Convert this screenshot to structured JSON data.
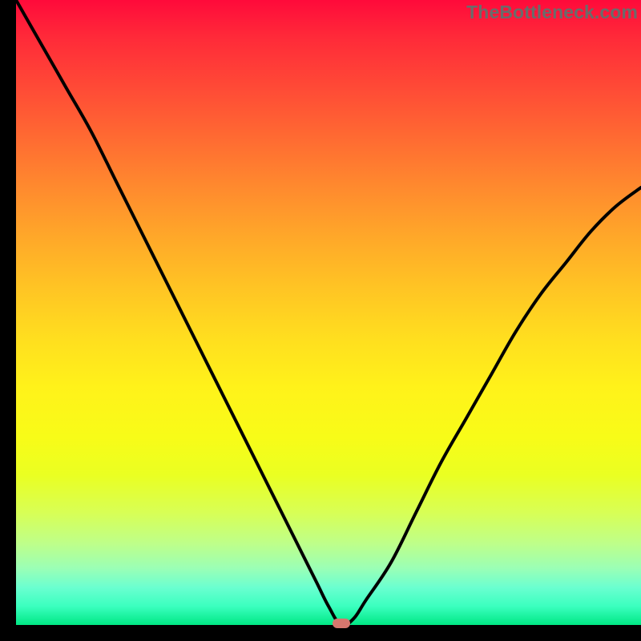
{
  "watermark": "TheBottleneck.com",
  "chart_data": {
    "type": "line",
    "title": "",
    "xlabel": "",
    "ylabel": "",
    "xlim": [
      0,
      100
    ],
    "ylim": [
      0,
      100
    ],
    "grid": false,
    "legend": false,
    "background_gradient": {
      "top_color": "#ff0a3a",
      "bottom_color": "#00e884",
      "stops": [
        "red",
        "orange",
        "yellow",
        "green"
      ]
    },
    "series": [
      {
        "name": "bottleneck-curve",
        "color": "#000000",
        "x": [
          0,
          4,
          8,
          12,
          16,
          20,
          24,
          28,
          32,
          36,
          40,
          44,
          48,
          50,
          52,
          54,
          56,
          60,
          64,
          68,
          72,
          76,
          80,
          84,
          88,
          92,
          96,
          100
        ],
        "values": [
          100,
          93,
          86,
          79,
          71,
          63,
          55,
          47,
          39,
          31,
          23,
          15,
          7,
          3,
          0,
          1,
          4,
          10,
          18,
          26,
          33,
          40,
          47,
          53,
          58,
          63,
          67,
          70
        ]
      }
    ],
    "marker": {
      "name": "optimal-point",
      "x": 52,
      "y": 0,
      "color": "#d6776e"
    }
  }
}
